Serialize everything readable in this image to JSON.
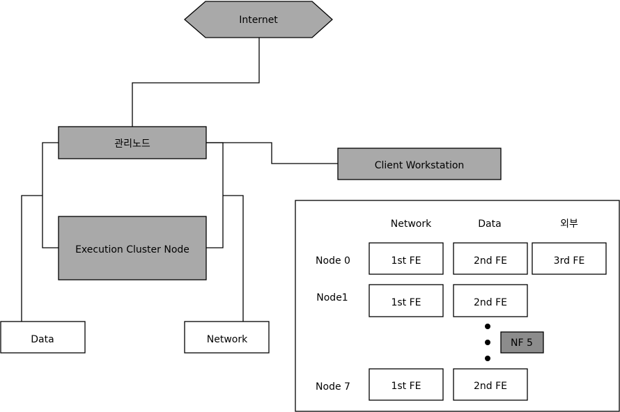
{
  "colors": {
    "node_fill": "#a9a9a9",
    "box_fill": "#ffffff",
    "stroke": "#000000",
    "nf_fill": "#8c8c8c"
  },
  "nodes": {
    "internet": "Internet",
    "management": "관리노드",
    "execution": "Execution Cluster Node",
    "client": "Client Workstation",
    "data": "Data",
    "network": "Network"
  },
  "table": {
    "columns": [
      "Network",
      "Data",
      "외부"
    ],
    "rows": [
      {
        "label": "Node 0",
        "cells": [
          "1st FE",
          "2nd FE",
          "3rd FE"
        ]
      },
      {
        "label": "Node1",
        "cells": [
          "1st FE",
          "2nd FE"
        ]
      },
      {
        "label": "Node 7",
        "cells": [
          "1st FE",
          "2nd FE"
        ]
      }
    ],
    "nf_label": "NF 5"
  }
}
